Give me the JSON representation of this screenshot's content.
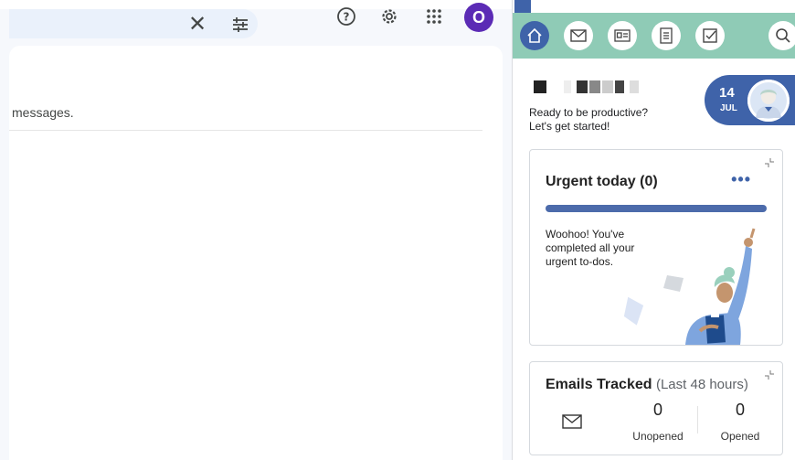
{
  "gmail": {
    "clear_search_icon": "close-icon",
    "filter_icon": "tune-icon",
    "help_icon": "help-icon",
    "settings_icon": "gear-icon",
    "apps_icon": "grid-icon",
    "account_initial": "O",
    "messages_text": "messages."
  },
  "sidebar": {
    "nav_icons": [
      "home-icon",
      "mail-icon",
      "contact-card-icon",
      "document-icon",
      "task-check-icon",
      "search-icon"
    ],
    "greeting_line1": "Ready to be productive?",
    "greeting_line2": "Let's get started!",
    "date_day": "14",
    "date_month": "JUL",
    "urgent": {
      "title": "Urgent today (0)",
      "more": "•••",
      "progress_percent": 100,
      "message": "Woohoo! You've completed all your urgent to-dos."
    },
    "emails": {
      "title": "Emails Tracked",
      "subtitle": "(Last 48 hours)",
      "unopened_count": "0",
      "unopened_label": "Unopened",
      "opened_count": "0",
      "opened_label": "Opened"
    }
  },
  "colors": {
    "nav_bg": "#8fcbb6",
    "brand_blue": "#3f63a9",
    "avatar_purple": "#5b2bb5"
  }
}
